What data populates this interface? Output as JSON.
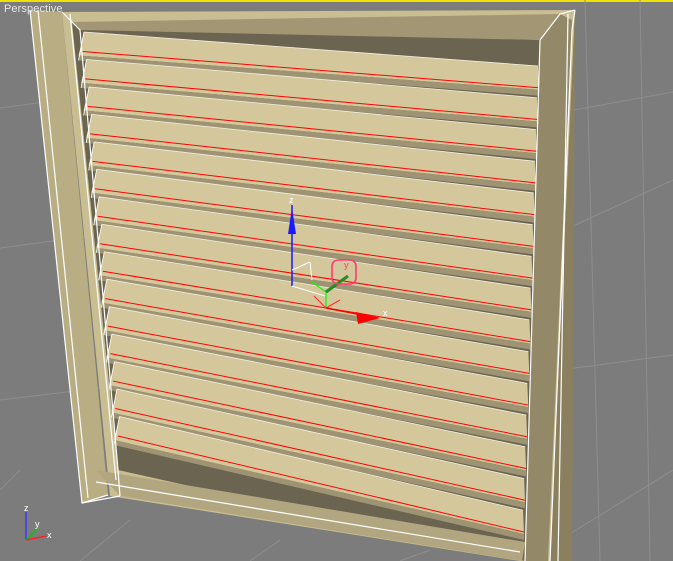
{
  "viewport": {
    "label": "Perspective",
    "active": true,
    "colors": {
      "background": "#7c7c7c",
      "grid": "#8e8e8e",
      "active_border": "#f0e200",
      "frame_face": "#c9bd92",
      "frame_shadow": "#8a7f5e",
      "slat_face": "#d4c79c",
      "slat_edge": "#ff0000",
      "wire": "#ffffff"
    }
  },
  "gizmo": {
    "type": "move-transform-gizmo",
    "axes": {
      "x": "x",
      "y": "y",
      "z": "z"
    },
    "colors": {
      "x": "#ff0000",
      "y": "#00ff00",
      "z": "#0000ff",
      "highlight": "#ff3c6e"
    }
  },
  "view_axis_tripod": {
    "axes": {
      "x": "x",
      "y": "y",
      "z": "z"
    }
  },
  "model": {
    "name": "louvered-window-frame",
    "slat_count": 15
  }
}
